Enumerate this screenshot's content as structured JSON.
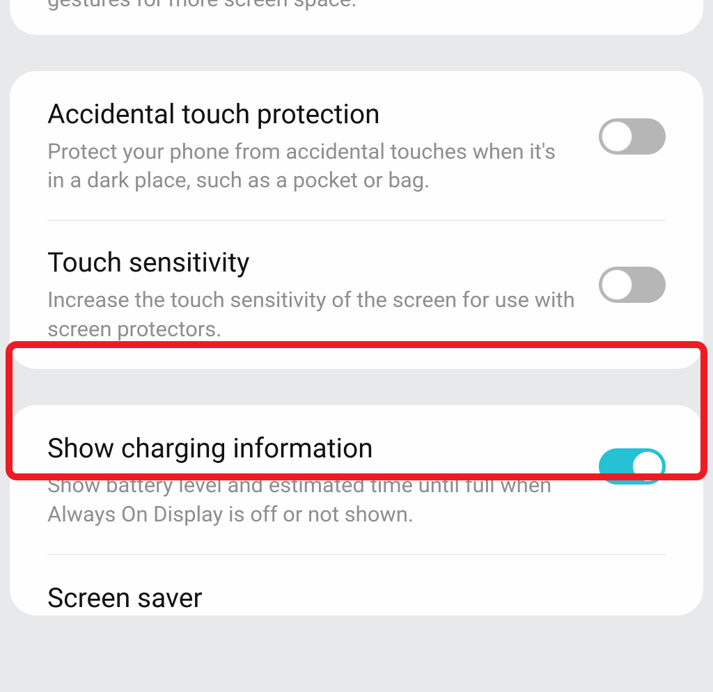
{
  "topFragment": {
    "description": "gestures for more screen space."
  },
  "group1": {
    "items": [
      {
        "title": "Accidental touch protection",
        "description": "Protect your phone from accidental touches when it's in a dark place, such as a pocket or bag.",
        "enabled": false
      },
      {
        "title": "Touch sensitivity",
        "description": "Increase the touch sensitivity of the screen for use with screen protectors.",
        "enabled": false
      }
    ]
  },
  "group2": {
    "items": [
      {
        "title": "Show charging information",
        "description": "Show battery level and estimated time until full when Always On Display is off or not shown.",
        "enabled": true
      },
      {
        "title": "Screen saver"
      }
    ]
  }
}
